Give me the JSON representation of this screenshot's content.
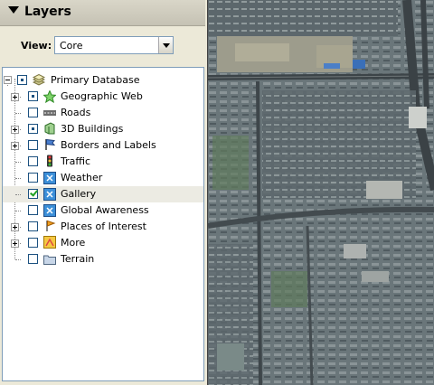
{
  "panel": {
    "title": "Layers"
  },
  "view": {
    "label": "View:",
    "selected": "Core"
  },
  "tree": {
    "root": {
      "label": "Primary Database"
    },
    "items": [
      {
        "label": "Geographic Web",
        "icon": "star-icon"
      },
      {
        "label": "Roads",
        "icon": "road-icon"
      },
      {
        "label": "3D Buildings",
        "icon": "building-icon"
      },
      {
        "label": "Borders and Labels",
        "icon": "flag-icon"
      },
      {
        "label": "Traffic",
        "icon": "traffic-light-icon"
      },
      {
        "label": "Weather",
        "icon": "weather-icon"
      },
      {
        "label": "Gallery",
        "icon": "gallery-icon"
      },
      {
        "label": "Global Awareness",
        "icon": "globe-awareness-icon"
      },
      {
        "label": "Places of Interest",
        "icon": "pin-flag-icon"
      },
      {
        "label": "More",
        "icon": "more-icon"
      },
      {
        "label": "Terrain",
        "icon": "folder-icon"
      }
    ]
  },
  "colors": {
    "accent": "#1c5180",
    "selected_row": "#ecebe3",
    "check": "#21a121"
  }
}
